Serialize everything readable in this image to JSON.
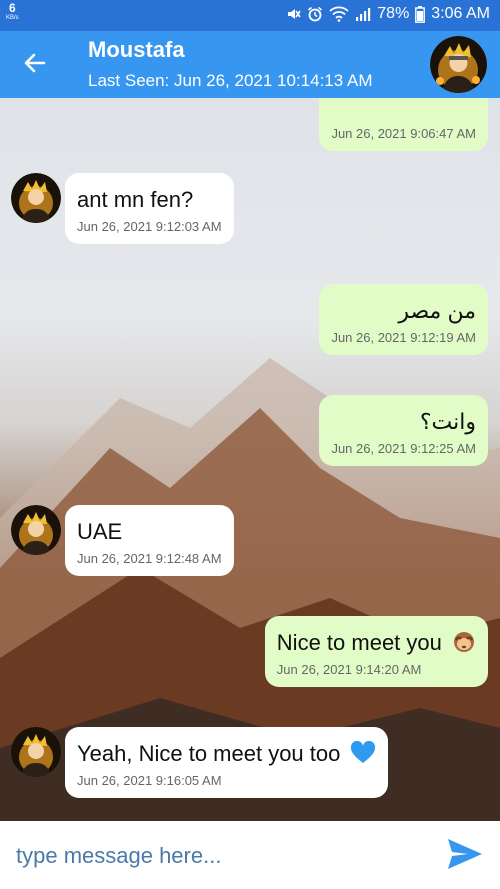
{
  "status_bar": {
    "net_speed": "6",
    "net_unit": "KB/s",
    "battery": "78%",
    "time": "3:06 AM"
  },
  "header": {
    "title": "Moustafa",
    "subtitle": "Last Seen: Jun 26, 2021 10:14:13 AM"
  },
  "messages": [
    {
      "direction": "out",
      "text": "",
      "time": "Jun 26, 2021 9:06:47 AM"
    },
    {
      "direction": "in",
      "text": "ant mn fen?",
      "time": "Jun 26, 2021 9:12:03 AM"
    },
    {
      "direction": "out",
      "text": "من مصر",
      "time": "Jun 26, 2021 9:12:19 AM"
    },
    {
      "direction": "out",
      "text": "وانت؟",
      "time": "Jun 26, 2021 9:12:25 AM"
    },
    {
      "direction": "in",
      "text": "UAE",
      "time": "Jun 26, 2021 9:12:48 AM"
    },
    {
      "direction": "out",
      "text": "Nice to meet you",
      "emoji": "monkey-icon",
      "time": "Jun 26, 2021 9:14:20 AM"
    },
    {
      "direction": "in",
      "text": "Yeah, Nice to meet you too",
      "emoji": "blue-heart-icon",
      "time": "Jun 26, 2021 9:16:05 AM"
    }
  ],
  "composer": {
    "placeholder": "type message here..."
  },
  "colors": {
    "status_bar": "#2a73d6",
    "app_bar": "#3696f0",
    "outgoing_bubble": "#e2fcc8",
    "incoming_bubble": "#ffffff",
    "send_icon": "#3696f0"
  }
}
